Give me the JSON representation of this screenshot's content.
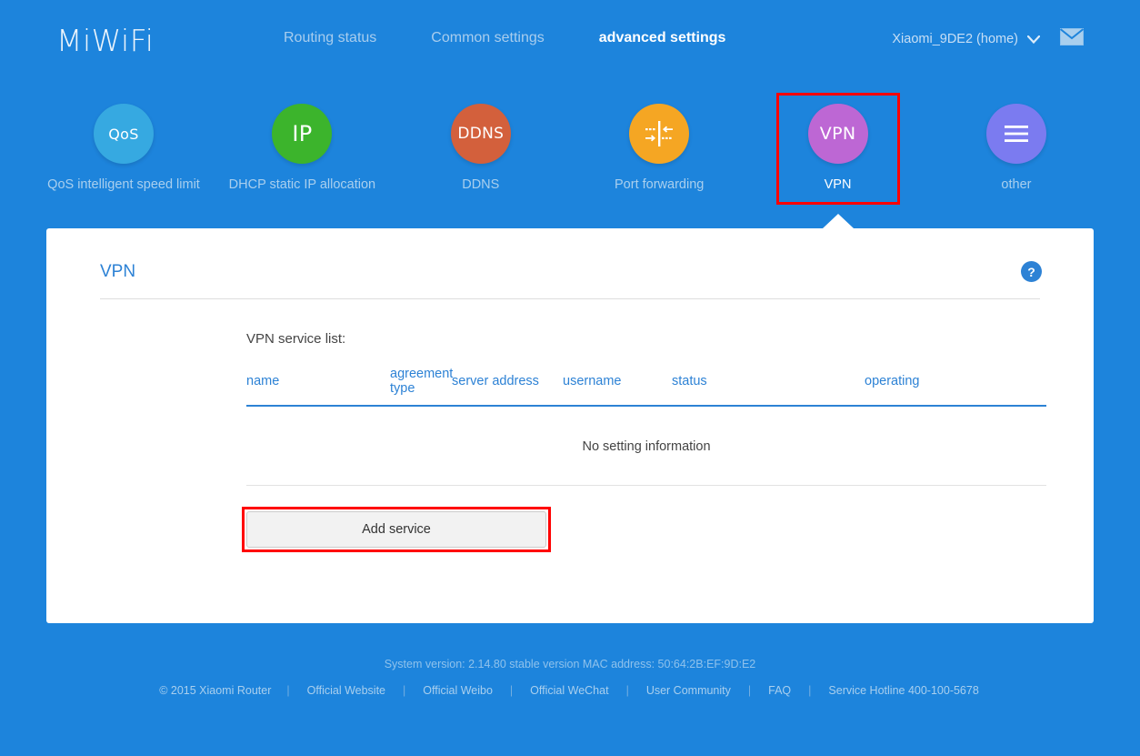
{
  "header": {
    "logo": "MiWiFi",
    "nav": [
      {
        "label": "Routing status",
        "active": false
      },
      {
        "label": "Common settings",
        "active": false
      },
      {
        "label": "advanced settings",
        "active": true
      }
    ],
    "device_name": "Xiaomi_9DE2 (home)",
    "chevron": "∨",
    "mail_icon": "mail-icon"
  },
  "tiles": [
    {
      "glyph": "QoS",
      "label": "QoS intelligent speed limit",
      "color": "#36a9e1",
      "icon": "qos-icon",
      "selected": false
    },
    {
      "glyph": "IP",
      "label": "DHCP static IP allocation",
      "color": "#3cb42c",
      "icon": "dhcp-ip-icon",
      "selected": false
    },
    {
      "glyph": "DDNS",
      "label": "DDNS",
      "color": "#d3603c",
      "icon": "ddns-icon",
      "selected": false
    },
    {
      "glyph": "",
      "label": "Port forwarding",
      "color": "#f5a623",
      "icon": "port-forwarding-icon",
      "selected": false
    },
    {
      "glyph": "VPN",
      "label": "VPN",
      "color": "#bd67d4",
      "icon": "vpn-icon",
      "selected": true
    },
    {
      "glyph": "",
      "label": "other",
      "color": "#7b7bf0",
      "icon": "hamburger-icon",
      "selected": false
    }
  ],
  "panel": {
    "title": "VPN",
    "help_label": "?",
    "list_caption": "VPN service list:",
    "columns": [
      "name",
      "agreement type",
      "server address",
      "username",
      "status",
      "operating"
    ],
    "rows": [],
    "empty_message": "No setting information",
    "add_button": "Add service"
  },
  "footer": {
    "version_line": "System version: 2.14.80 stable version MAC address: 50:64:2B:EF:9D:E2",
    "copyright": "© 2015 Xiaomi Router",
    "separator": "|",
    "links": [
      "Official Website",
      "Official Weibo",
      "Official WeChat",
      "User Community",
      "FAQ",
      "Service Hotline 400-100-5678"
    ]
  },
  "colors": {
    "background": "#1d84dc",
    "accent": "#2d82d5",
    "highlight": "#ff0000",
    "card": "#ffffff"
  }
}
